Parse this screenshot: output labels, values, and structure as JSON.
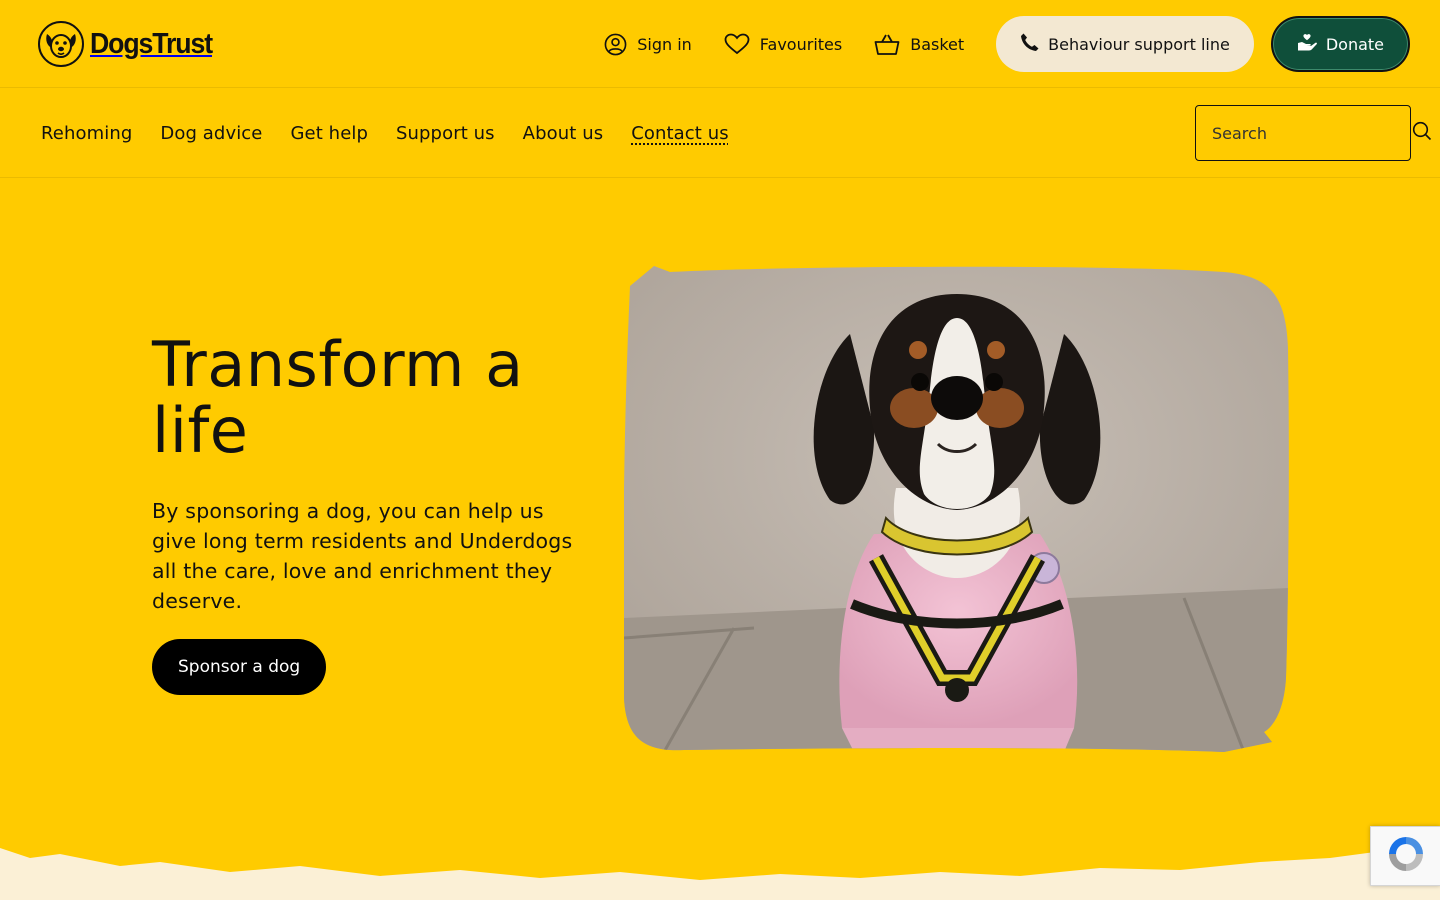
{
  "brand": {
    "name": "DogsTrust"
  },
  "utility_nav": {
    "sign_in": "Sign in",
    "favourites": "Favourites",
    "basket": "Basket",
    "behaviour_support": "Behaviour support line",
    "donate": "Donate"
  },
  "main_nav": {
    "items": [
      "Rehoming",
      "Dog advice",
      "Get help",
      "Support us",
      "About us",
      "Contact us"
    ],
    "current": "Contact us"
  },
  "search": {
    "placeholder": "Search"
  },
  "hero": {
    "title_line1": "Transform a",
    "title_line2": "life",
    "body": "By sponsoring a dog, you can help us give long term residents and Underdogs all the care, love and enrichment they deserve.",
    "cta": "Sponsor a dog"
  },
  "colors": {
    "background": "#ffcb00",
    "donate": "#0f4f3a",
    "support_pill": "#f3e8d2",
    "cta": "#000000",
    "footer_cream": "#fbf0d6"
  },
  "icons": [
    "dogs-trust-logo-icon",
    "user-circle-icon",
    "heart-icon",
    "basket-icon",
    "phone-icon",
    "donate-hand-icon",
    "search-icon",
    "recaptcha-icon"
  ]
}
